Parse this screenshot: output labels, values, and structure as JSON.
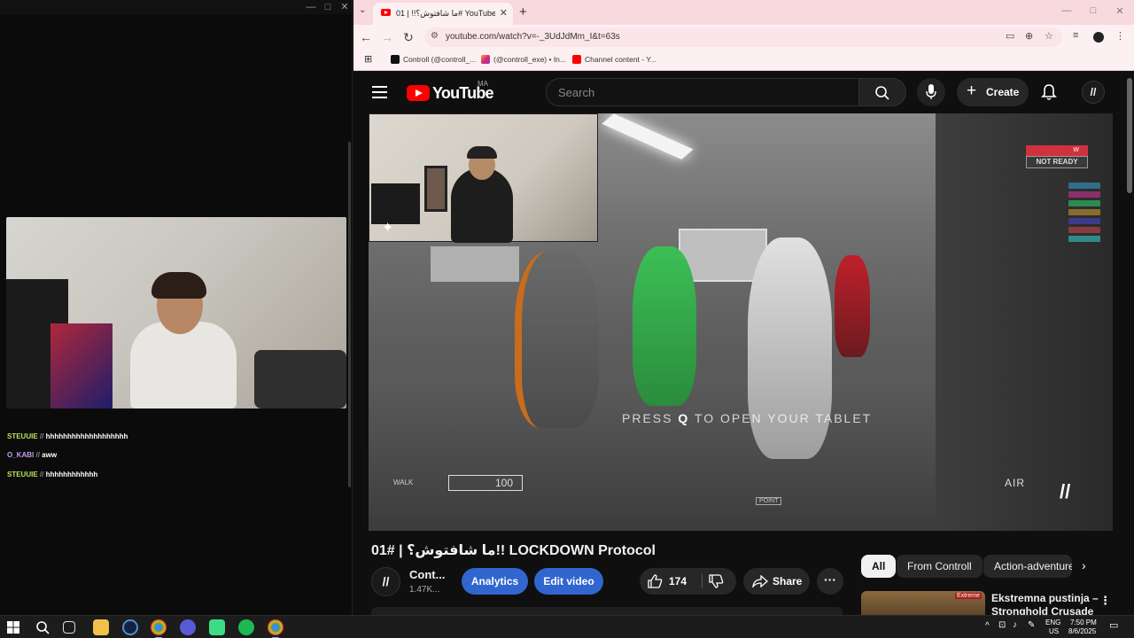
{
  "left_window": {
    "chat": [
      {
        "user": "STEUUIE",
        "sep": "//",
        "message": "hhhhhhhhhhhhhhhhhhh"
      },
      {
        "user": "O_KABI",
        "sep": "//",
        "message": "aww"
      },
      {
        "user": "STEUUIE",
        "sep": "//",
        "message": "hhhhhhhhhhhh"
      }
    ]
  },
  "browser": {
    "tab_title": "ما شافتوش؟!! | 01# YouTube",
    "url": "youtube.com/watch?v=-_3UdJdMm_I&t=63s",
    "bookmarks": [
      {
        "label": "Controll (@controll_...",
        "icon": "tiktok-icon"
      },
      {
        "label": "(@controll_exe) • In...",
        "icon": "instagram-icon"
      },
      {
        "label": "Channel content - Y...",
        "icon": "youtube-icon"
      }
    ]
  },
  "youtube": {
    "logo_text": "YouTube",
    "region": "MA",
    "search_placeholder": "Search",
    "create_label": "Create",
    "avatar_letter": "//",
    "video": {
      "hud_prompt_prefix": "PRESS",
      "hud_prompt_key": "Q",
      "hud_prompt_suffix": "TO OPEN YOUR TABLET",
      "hud_status_top": "W",
      "hud_status": "NOT READY",
      "hud_health": "100",
      "hud_air": "AIR",
      "hud_point": "POINT",
      "hud_walk": "WALK"
    },
    "title": "01# | ما شافتوش؟!! LOCKDOWN Protocol",
    "channel_name": "Cont...",
    "channel_subs": "1.47K...",
    "channel_avatar": "//",
    "analytics_label": "Analytics",
    "edit_label": "Edit video",
    "like_count": "174",
    "share_label": "Share",
    "chips": [
      "All",
      "From Controll",
      "Action-adventure"
    ],
    "recommended": {
      "title": "Ekstremna pustinja – Stronghold Crusade",
      "badge": "Extreme"
    }
  },
  "taskbar": {
    "lang_top": "ENG",
    "lang_bottom": "US",
    "time": "7:50 PM",
    "date": "8/6/2025"
  },
  "colors": {
    "yt_red": "#ff0000",
    "accent_blue": "#3166cf",
    "tab_pink": "#f8d9de",
    "chat_green": "#b7e35a"
  }
}
